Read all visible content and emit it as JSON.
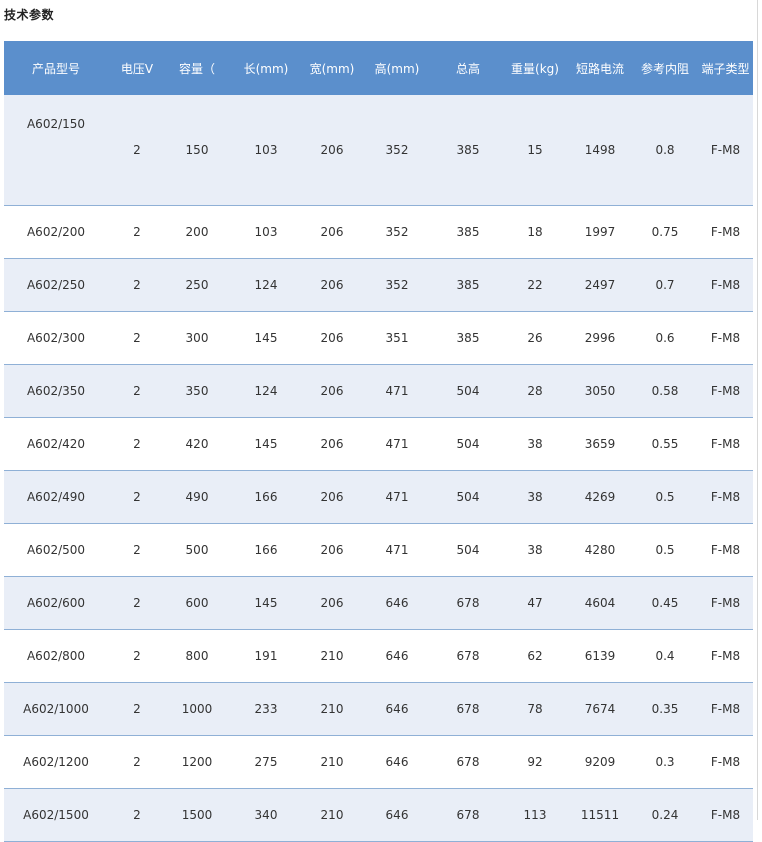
{
  "title": "技术参数",
  "columns": [
    "产品型号",
    "电压V",
    "容量（",
    "长(mm)",
    "宽(mm)",
    "高(mm)",
    "总高",
    "重量(kg)",
    "短路电流",
    "参考内阻",
    "端子类型"
  ],
  "rows": [
    [
      "A602/150",
      "2",
      "150",
      "103",
      "206",
      "352",
      "385",
      "15",
      "1498",
      "0.8",
      "F-M8"
    ],
    [
      "A602/200",
      "2",
      "200",
      "103",
      "206",
      "352",
      "385",
      "18",
      "1997",
      "0.75",
      "F-M8"
    ],
    [
      "A602/250",
      "2",
      "250",
      "124",
      "206",
      "352",
      "385",
      "22",
      "2497",
      "0.7",
      "F-M8"
    ],
    [
      "A602/300",
      "2",
      "300",
      "145",
      "206",
      "351",
      "385",
      "26",
      "2996",
      "0.6",
      "F-M8"
    ],
    [
      "A602/350",
      "2",
      "350",
      "124",
      "206",
      "471",
      "504",
      "28",
      "3050",
      "0.58",
      "F-M8"
    ],
    [
      "A602/420",
      "2",
      "420",
      "145",
      "206",
      "471",
      "504",
      "38",
      "3659",
      "0.55",
      "F-M8"
    ],
    [
      "A602/490",
      "2",
      "490",
      "166",
      "206",
      "471",
      "504",
      "38",
      "4269",
      "0.5",
      "F-M8"
    ],
    [
      "A602/500",
      "2",
      "500",
      "166",
      "206",
      "471",
      "504",
      "38",
      "4280",
      "0.5",
      "F-M8"
    ],
    [
      "A602/600",
      "2",
      "600",
      "145",
      "206",
      "646",
      "678",
      "47",
      "4604",
      "0.45",
      "F-M8"
    ],
    [
      "A602/800",
      "2",
      "800",
      "191",
      "210",
      "646",
      "678",
      "62",
      "6139",
      "0.4",
      "F-M8"
    ],
    [
      "A602/1000",
      "2",
      "1000",
      "233",
      "210",
      "646",
      "678",
      "78",
      "7674",
      "0.35",
      "F-M8"
    ],
    [
      "A602/1200",
      "2",
      "1200",
      "275",
      "210",
      "646",
      "678",
      "92",
      "9209",
      "0.3",
      "F-M8"
    ],
    [
      "A602/1500",
      "2",
      "1500",
      "340",
      "210",
      "646",
      "678",
      "113",
      "11511",
      "0.24",
      "F-M8"
    ]
  ],
  "colors": {
    "header_bg": "#5b8fcc",
    "header_text": "#ffffff",
    "row_alt_bg": "#e9eef7",
    "row_border": "#8fb0d6"
  }
}
